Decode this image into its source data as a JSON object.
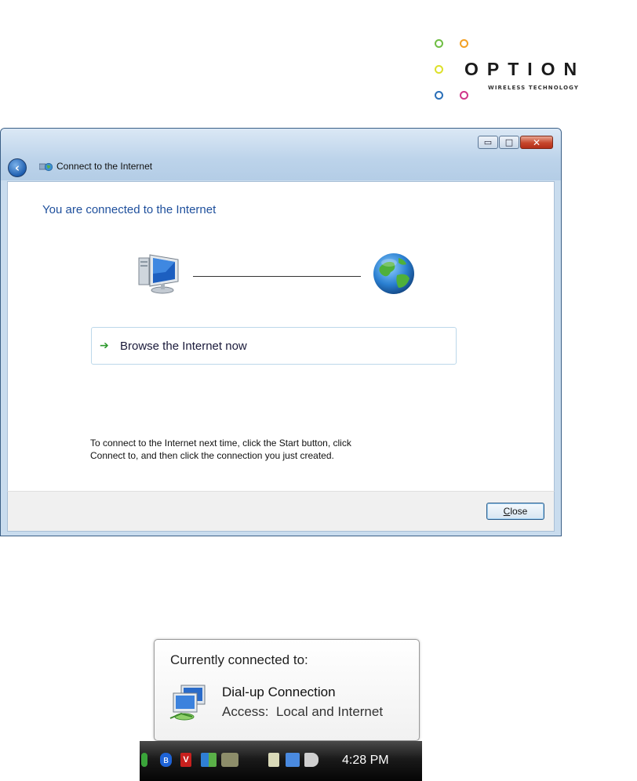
{
  "logo": {
    "wordmark": "OPTION",
    "tagline": "WIRELESS TECHNOLOGY",
    "circle_colors": [
      "#6fbe44",
      "#f3a023",
      "#dde02a",
      "#1d1d1d",
      "#2a6fb8",
      "#d0368a"
    ]
  },
  "window": {
    "title": "Connect to the Internet",
    "controls": {
      "minimize": "▭",
      "maximize": "□",
      "close": "✕"
    },
    "heading": "You are connected to the Internet",
    "link_label": "Browse the Internet now",
    "hint_line1": "To connect to the Internet next time, click the Start button, click",
    "hint_line2": "Connect to, and then click the connection you just created.",
    "close_button": {
      "mnemonic": "C",
      "rest": "lose"
    },
    "colors": {
      "heading": "#1e4f9c",
      "link_arrow": "#2f9a2f"
    }
  },
  "balloon": {
    "header": "Currently connected to:",
    "connection_name": "Dial-up Connection",
    "access": "Access:  Local and Internet"
  },
  "taskbar": {
    "clock": "4:28 PM",
    "tray_icons": [
      "security-check-icon",
      "bluetooth-icon",
      "antivirus-icon",
      "network-monitor-icon",
      "update-alert-icon",
      "power-icon",
      "network-icon",
      "volume-muted-icon"
    ]
  }
}
